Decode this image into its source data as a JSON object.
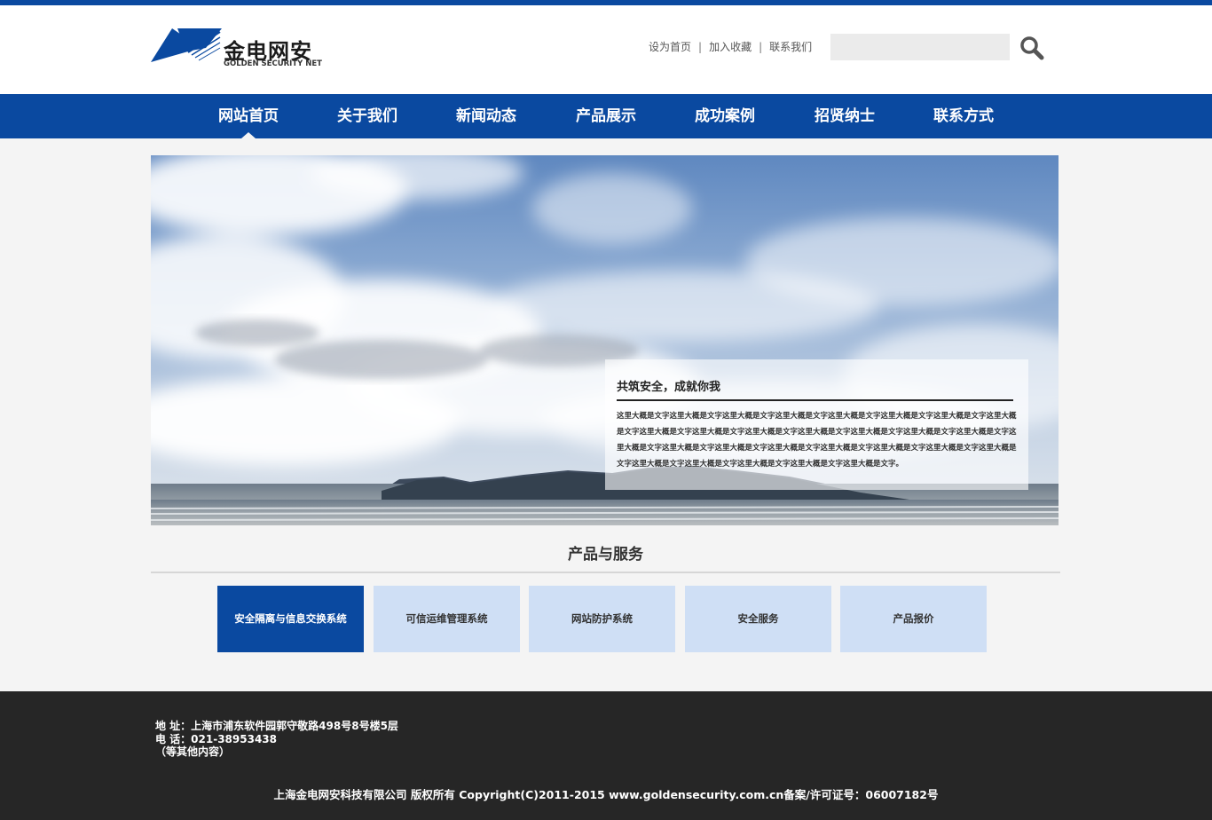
{
  "colors": {
    "brand_blue": "#0a49a0",
    "light_blue": "#cfdff5",
    "footer_bg": "#262626",
    "page_bg": "#f4f4f4"
  },
  "header": {
    "logo_cn": "金电网安",
    "logo_en": "GOLDEN SECURITY NET",
    "links": [
      "设为首页",
      "加入收藏",
      "联系我们"
    ],
    "search": {
      "placeholder": "",
      "icon": "search-icon"
    }
  },
  "nav": {
    "items": [
      "网站首页",
      "关于我们",
      "新闻动态",
      "产品展示",
      "成功案例",
      "招贤纳士",
      "联系方式"
    ],
    "active_index": 0
  },
  "banner": {
    "title": "共筑安全，成就你我",
    "body": "这里大概是文字这里大概是文字这里大概是文字这里大概是文字这里大概是文字这里大概是文字这里大概是文字这里大概是文字这里大概是文字这里大概是文字这里大概是文字这里大概是文字这里大概是文字这里大概是文字这里大概是文字这里大概是文字这里大概是文字这里大概是文字这里大概是文字这里大概是文字这里大概是文字这里大概是文字这里大概是文字这里大概是文字这里大概是文字这里大概是文字这里大概是文字这里大概是文字。"
  },
  "products": {
    "title": "产品与服务",
    "items": [
      "安全隔离与信息交换系统",
      "可信运维管理系统",
      "网站防护系统",
      "安全服务",
      "产品报价"
    ],
    "active_index": 0
  },
  "footer": {
    "address": "地  址：上海市浦东软件园郭守敬路498号8号楼5层",
    "phone": "电  话：021-38953438",
    "other": "（等其他内容）",
    "copyright": "上海金电网安科技有限公司 版权所有 Copyright(C)2011-2015 www.goldensecurity.com.cn备案/许可证号：06007182号"
  }
}
